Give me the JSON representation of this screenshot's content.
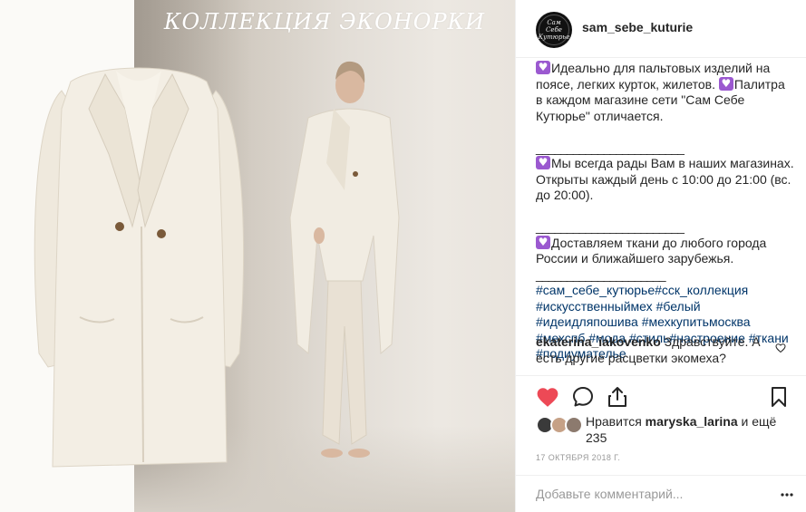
{
  "media": {
    "collection_title": "КОЛЛЕКЦИЯ ЭКОНОРКИ"
  },
  "header": {
    "avatar_text": "Сам Себе Кутюрье",
    "username": "sam_sebe_kuturie"
  },
  "caption": {
    "p1": "Идеально для пальтовых изделий на поясе, легких курток, жилетов.",
    "p1b": "Палитра в каждом магазине сети \"Сам Себе Кутюрье\" отличается.",
    "divider1": "________________________",
    "p2": "Мы всегда рады Вам в наших магазинах. Открыты каждый день с 10:00 до 21:00 (вс. до 20:00).",
    "divider2": "________________________",
    "p3": "Доставляем ткани до любого города России и ближайшего зарубежья.",
    "divider3": "_____________________",
    "hashtags": [
      "#сам_себе_кутюрье",
      "#сск_коллекция",
      "#искусственныймех",
      "#белый",
      "#идеидляпошива",
      "#мехкупитьмосква",
      "#мехспб",
      "#мода",
      "#стиль",
      "#настроение",
      "#ткани",
      "#подиумателье"
    ]
  },
  "comment": {
    "user": "ekaterina_iakovenko",
    "text": "Здравствуйте. А есть другие расцветки экомеха?"
  },
  "likes": {
    "prefix": "Нравится",
    "user": "maryska_larina",
    "suffix": "и ещё 235"
  },
  "date": "17 ОКТЯБРЯ 2018 Г.",
  "comment_box": {
    "placeholder": "Добавьте комментарий..."
  },
  "colors": {
    "heart_red": "#ed4956",
    "purple_heart": "#9b59d0",
    "hashtag": "#003569",
    "text": "#262626",
    "muted": "#999999"
  },
  "icons": [
    "heart-icon",
    "comment-icon",
    "share-icon",
    "bookmark-icon",
    "more-icon",
    "purple-heart-icon"
  ]
}
